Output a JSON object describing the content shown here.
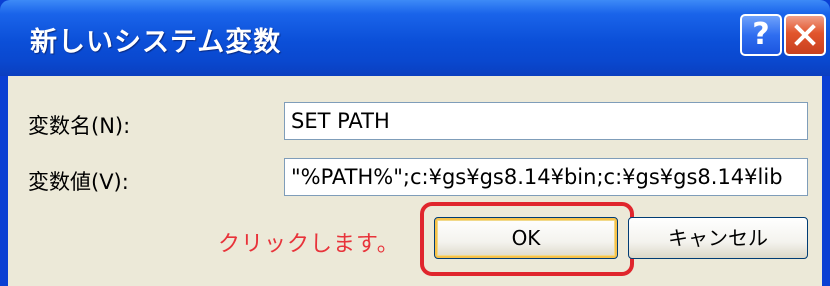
{
  "window": {
    "title": "新しいシステム変数",
    "help_label": "?"
  },
  "form": {
    "name_label": "変数名(N):",
    "name_value": "SET PATH",
    "value_label": "変数値(V):",
    "value_value": "\"%PATH%\";c:¥gs¥gs8.14¥bin;c:¥gs¥gs8.14¥lib"
  },
  "annotation": {
    "text": "クリックします。",
    "color": "#e8333a"
  },
  "buttons": {
    "ok_label": "OK",
    "cancel_label": "キャンセル"
  },
  "icons": {
    "help": "help-icon",
    "close": "close-icon"
  }
}
